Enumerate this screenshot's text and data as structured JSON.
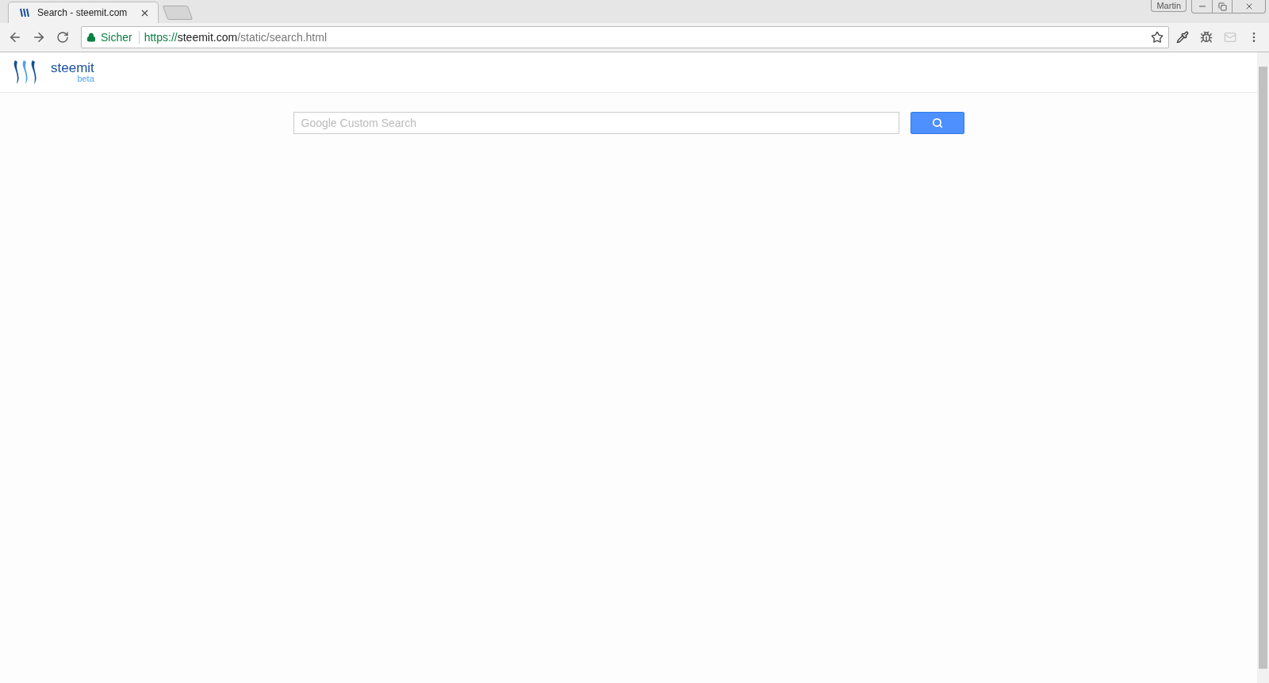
{
  "browser": {
    "tab": {
      "title": "Search - steemit.com"
    },
    "profile": "Martin",
    "security": "Sicher",
    "url": {
      "scheme": "https://",
      "host": "steemit.com",
      "path": "/static/search.html"
    }
  },
  "header": {
    "brand": "steemit",
    "tag": "beta"
  },
  "search": {
    "placeholder": "Google Custom Search"
  }
}
